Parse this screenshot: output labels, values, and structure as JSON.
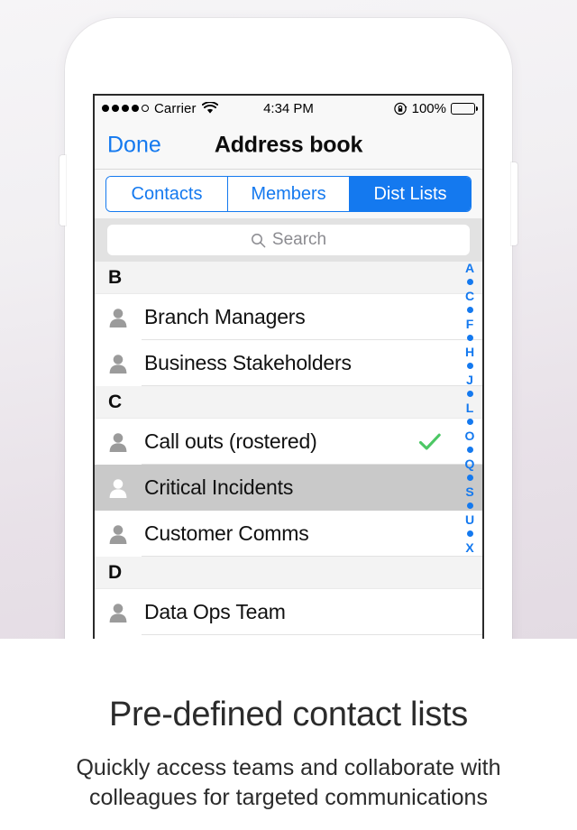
{
  "status_bar": {
    "signal_dots_filled": 4,
    "signal_dots_empty": 1,
    "carrier": "Carrier",
    "wifi_icon": "wifi-icon",
    "time": "4:34 PM",
    "rotation_lock_icon": "rotation-lock-icon",
    "battery_percent": "100%",
    "battery_icon": "battery-full-icon"
  },
  "nav_bar": {
    "left_button": "Done",
    "title": "Address book"
  },
  "segmented_control": {
    "segments": [
      {
        "label": "Contacts",
        "selected": false
      },
      {
        "label": "Members",
        "selected": false
      },
      {
        "label": "Dist Lists",
        "selected": true
      }
    ]
  },
  "search": {
    "icon": "search-icon",
    "placeholder": "Search",
    "value": ""
  },
  "list": {
    "sections": [
      {
        "header": "B",
        "rows": [
          {
            "label": "Branch Managers",
            "icon": "person-icon",
            "checked": false,
            "selected": false
          },
          {
            "label": "Business Stakeholders",
            "icon": "person-icon",
            "checked": false,
            "selected": false
          }
        ]
      },
      {
        "header": "C",
        "rows": [
          {
            "label": "Call outs (rostered)",
            "icon": "person-icon",
            "checked": true,
            "selected": false
          },
          {
            "label": "Critical Incidents",
            "icon": "person-icon",
            "checked": false,
            "selected": true
          },
          {
            "label": "Customer Comms",
            "icon": "person-icon",
            "checked": false,
            "selected": false
          }
        ]
      },
      {
        "header": "D",
        "rows": [
          {
            "label": "Data Ops Team",
            "icon": "person-icon",
            "checked": false,
            "selected": false
          }
        ]
      }
    ]
  },
  "index_bar": {
    "entries": [
      "A",
      "•",
      "C",
      "•",
      "F",
      "•",
      "H",
      "•",
      "J",
      "•",
      "L",
      "•",
      "O",
      "•",
      "Q",
      "•",
      "S",
      "•",
      "U",
      "•",
      "X"
    ]
  },
  "caption": {
    "title": "Pre-defined contact lists",
    "subtitle": "Quickly access teams and collaborate with colleagues for targeted communications"
  },
  "colors": {
    "tint_blue": "#1479ef",
    "check_green": "#4cc764",
    "selected_row": "#c9c9c9",
    "search_band": "#e2e2e2",
    "section_header": "#f3f3f3"
  }
}
